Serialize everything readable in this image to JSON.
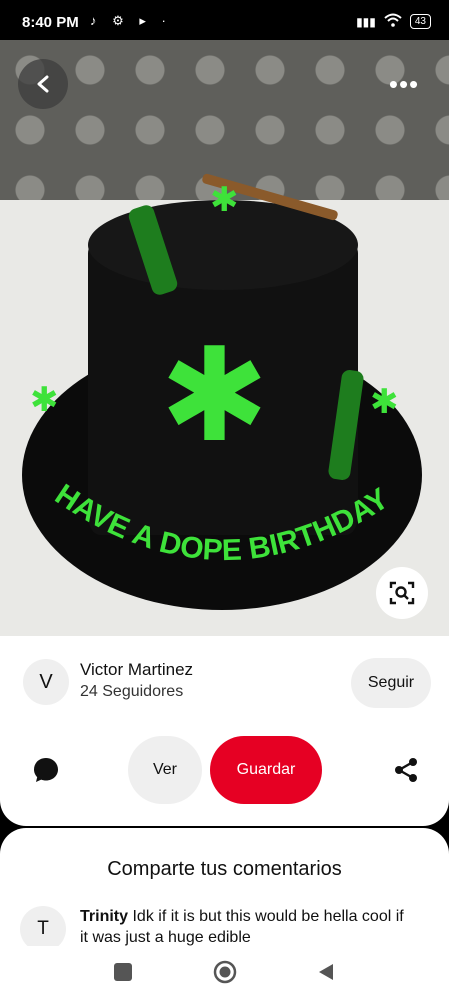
{
  "status_bar": {
    "time": "8:40 PM",
    "left_icons": "♪ ⚙ ▸ ·",
    "signal": "▮▮▮▮",
    "wifi": "wifi",
    "battery": "43"
  },
  "photo": {
    "cake_text": "HAVE A DOPE BIRTHDAY"
  },
  "pin": {
    "author_initial": "V",
    "author_name": "Victor Martinez",
    "followers": "24 Seguidores",
    "follow_label": "Seguir",
    "view_label": "Ver",
    "save_label": "Guardar"
  },
  "comments": {
    "title": "Comparte tus comentarios",
    "items": [
      {
        "initial": "T",
        "author": "Trinity",
        "text": "Idk if it is but this would be hella cool if it was just a huge edible"
      }
    ]
  },
  "colors": {
    "accent": "#e60023",
    "leaf": "#3ee23a"
  }
}
